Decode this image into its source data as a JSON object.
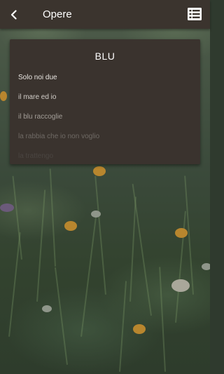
{
  "header": {
    "back_icon": "chevron-left-icon",
    "title": "Opere",
    "menu_icon": "list-icon"
  },
  "poem": {
    "title": "BLU",
    "lines": [
      "Solo noi due",
      "il mare ed io",
      "il blu raccoglie",
      "la rabbia che io non voglio",
      "la trattengo"
    ]
  },
  "colors": {
    "header_bg": "#3b342e",
    "card_bg": "#3a332e",
    "text_primary": "#ffffff"
  }
}
